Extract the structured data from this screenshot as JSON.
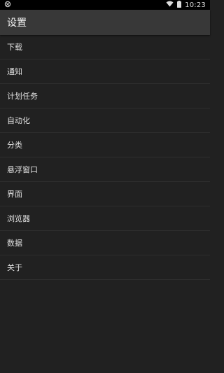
{
  "status_bar": {
    "time": "10:23",
    "left_icon": "app-notification-icon",
    "icons": [
      "wifi-icon",
      "battery-icon"
    ]
  },
  "app_bar": {
    "title": "设置"
  },
  "menu": {
    "items": [
      {
        "label": "下载"
      },
      {
        "label": "通知"
      },
      {
        "label": "计划任务"
      },
      {
        "label": "自动化"
      },
      {
        "label": "分类"
      },
      {
        "label": "悬浮窗口"
      },
      {
        "label": "界面"
      },
      {
        "label": "浏览器"
      },
      {
        "label": "数据"
      },
      {
        "label": "关于"
      }
    ]
  },
  "colors": {
    "background": "#212121",
    "app_bar": "#383838",
    "status_bar": "#000000",
    "divider": "#2e2e2e",
    "text": "#e0e0e0"
  }
}
